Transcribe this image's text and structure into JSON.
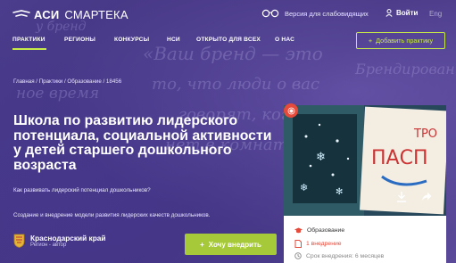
{
  "header": {
    "logo_primary": "АСИ",
    "logo_secondary": "СМАРТЕКА",
    "vision_label": "Версия для слабовидящих",
    "login_label": "Войти",
    "lang_label": "Eng"
  },
  "nav": {
    "items": [
      {
        "label": "ПРАКТИКИ"
      },
      {
        "label": "РЕГИОНЫ"
      },
      {
        "label": "КОНКУРСЫ"
      },
      {
        "label": "НСИ"
      },
      {
        "label": "ОТКРЫТО ДЛЯ ВСЕХ"
      },
      {
        "label": "О НАС"
      }
    ],
    "add_button": "Добавить практику",
    "active_color": "#c8e94a"
  },
  "breadcrumb": "Главная / Практики / Образование / 18456",
  "practice": {
    "title": "Школа по развитию лидерского потенциала, социальной активности у детей старшего дошкольного возраста",
    "subtitle": "Как развивать лидерский потенциал дошкольников?",
    "description": "Создание и внедрение модели развития лидерских качеств дошкольников.",
    "region_name": "Краснодарский край",
    "region_role": "Регион - автор",
    "implement_button": "Хочу внедрить"
  },
  "card": {
    "category": "Образование",
    "implementations": "1 внедрение",
    "duration": "Срок внедрения: 6 месяцев",
    "photo_sign_text": "ТРО ПАСП"
  },
  "colors": {
    "background": "#4a3a86",
    "accent_green": "#a6c93a",
    "accent_red": "#e64a3a"
  },
  "icons": [
    "logo-mark-icon",
    "glasses-icon",
    "user-icon",
    "plus-icon",
    "download-icon",
    "share-icon",
    "graduation-cap-icon",
    "document-icon",
    "clock-icon",
    "region-crest-icon",
    "badge-icon"
  ]
}
